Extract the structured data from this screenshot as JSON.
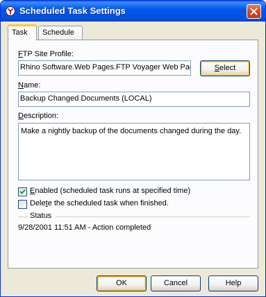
{
  "window": {
    "title": "Scheduled Task Settings"
  },
  "tabs": [
    {
      "label": "Task",
      "active": true
    },
    {
      "label": "Schedule",
      "active": false
    }
  ],
  "task": {
    "ftp_profile": {
      "label_mnemonic": "F",
      "label_rest": "TP Site Profile:",
      "value": "Rhino Software.Web Pages.FTP Voyager Web Pag",
      "select_button_mnemonic": "S",
      "select_button_rest": "elect"
    },
    "name": {
      "label_mnemonic": "N",
      "label_rest": "ame:",
      "value": "Backup Changed Documents (LOCAL)"
    },
    "description": {
      "label_mnemonic": "D",
      "label_rest": "escription:",
      "value": "Make a nightly backup of the documents changed during the day."
    },
    "enabled": {
      "checked": true,
      "label_mnemonic": "E",
      "label_rest": "nabled (scheduled task runs at specified time)"
    },
    "delete_when_finished": {
      "checked": false,
      "label_pre": "Dele",
      "label_mnemonic": "t",
      "label_rest": "e the scheduled task when finished."
    },
    "status": {
      "heading": "Status",
      "text": "9/28/2001 11:51 AM - Action completed"
    }
  },
  "buttons": {
    "ok": "OK",
    "cancel": "Cancel",
    "help": "Help"
  },
  "colors": {
    "titlebar": "#0058ee",
    "dialog_bg": "#ece9d8",
    "panel_bg": "#fcfcfe",
    "textbox_border": "#7f9db9",
    "tab_highlight": "#ffc83c",
    "close_button": "#d8461e"
  }
}
